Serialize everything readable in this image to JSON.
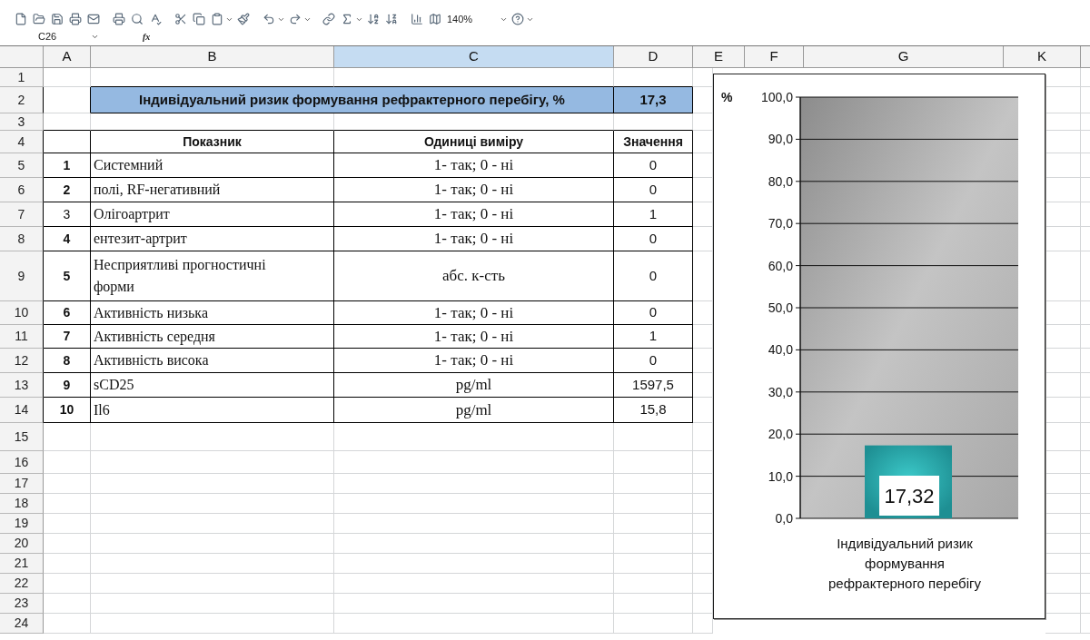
{
  "toolbar": {
    "zoom": "140%"
  },
  "formula_bar": {
    "name_box": "C26",
    "function_label": "fx"
  },
  "columns": [
    {
      "label": "A",
      "selected": false
    },
    {
      "label": "B",
      "selected": false
    },
    {
      "label": "C",
      "selected": true
    },
    {
      "label": "D",
      "selected": false
    },
    {
      "label": "E",
      "selected": false
    },
    {
      "label": "F",
      "selected": false
    },
    {
      "label": "G",
      "selected": false
    },
    {
      "label": "K",
      "selected": false
    }
  ],
  "row_numbers": [
    "1",
    "2",
    "3",
    "4",
    "5",
    "6",
    "7",
    "8",
    "9",
    "10",
    "11",
    "12",
    "13",
    "14",
    "15",
    "16",
    "17",
    "18",
    "19",
    "20",
    "21",
    "22",
    "23",
    "24"
  ],
  "title_cell": {
    "text": "Індивідуальний ризик формування рефрактерного перебігу, %",
    "value": "17,3"
  },
  "table": {
    "headers": [
      "Показник",
      "Одиниці виміру",
      "Значення"
    ],
    "rows": [
      {
        "index": "1",
        "bold_index": true,
        "name": "Системний",
        "unit": "1- так; 0 - ні",
        "value": "0"
      },
      {
        "index": "2",
        "bold_index": true,
        "name": "полі, RF-негативний",
        "unit": "1- так; 0 - ні",
        "value": "0"
      },
      {
        "index": "3",
        "bold_index": false,
        "name": "Олігоартрит",
        "unit": "1- так; 0 - ні",
        "value": "1"
      },
      {
        "index": "4",
        "bold_index": true,
        "name": "ентезит-артрит",
        "unit": "1- так; 0 - ні",
        "value": "0"
      },
      {
        "index": "5",
        "bold_index": true,
        "name": "Несприятливі прогностичні форми",
        "unit": "абс. к-сть",
        "value": "0"
      },
      {
        "index": "6",
        "bold_index": true,
        "name": "Активність низька",
        "unit": "1- так; 0 - ні",
        "value": "0"
      },
      {
        "index": "7",
        "bold_index": true,
        "name": "Активність середня",
        "unit": "1- так; 0 - ні",
        "value": "1"
      },
      {
        "index": "8",
        "bold_index": true,
        "name": "Активність висока",
        "unit": "1- так; 0 - ні",
        "value": "0"
      },
      {
        "index": "9",
        "bold_index": true,
        "name": "sCD25",
        "unit": "pg/ml",
        "value": "1597,5"
      },
      {
        "index": "10",
        "bold_index": true,
        "name": "Il6",
        "unit": "pg/ml",
        "value": "15,8"
      }
    ]
  },
  "chart": {
    "chart_data": {
      "type": "bar",
      "grid": true,
      "ylabel": "%",
      "categories": [
        "Індивідуальний ризик формування рефрактерного перебігу"
      ],
      "values": [
        17.32
      ],
      "ylim": [
        0,
        100
      ],
      "yticks": [
        {
          "value": 0,
          "label": "0,0"
        },
        {
          "value": 10,
          "label": "10,0"
        },
        {
          "value": 20,
          "label": "20,0"
        },
        {
          "value": 30,
          "label": "30,0"
        },
        {
          "value": 40,
          "label": "40,0"
        },
        {
          "value": 50,
          "label": "50,0"
        },
        {
          "value": 60,
          "label": "60,0"
        },
        {
          "value": 70,
          "label": "70,0"
        },
        {
          "value": 80,
          "label": "80,0"
        },
        {
          "value": 90,
          "label": "90,0"
        },
        {
          "value": 100,
          "label": "100,0"
        }
      ],
      "value_labels": [
        "17,32"
      ]
    }
  }
}
